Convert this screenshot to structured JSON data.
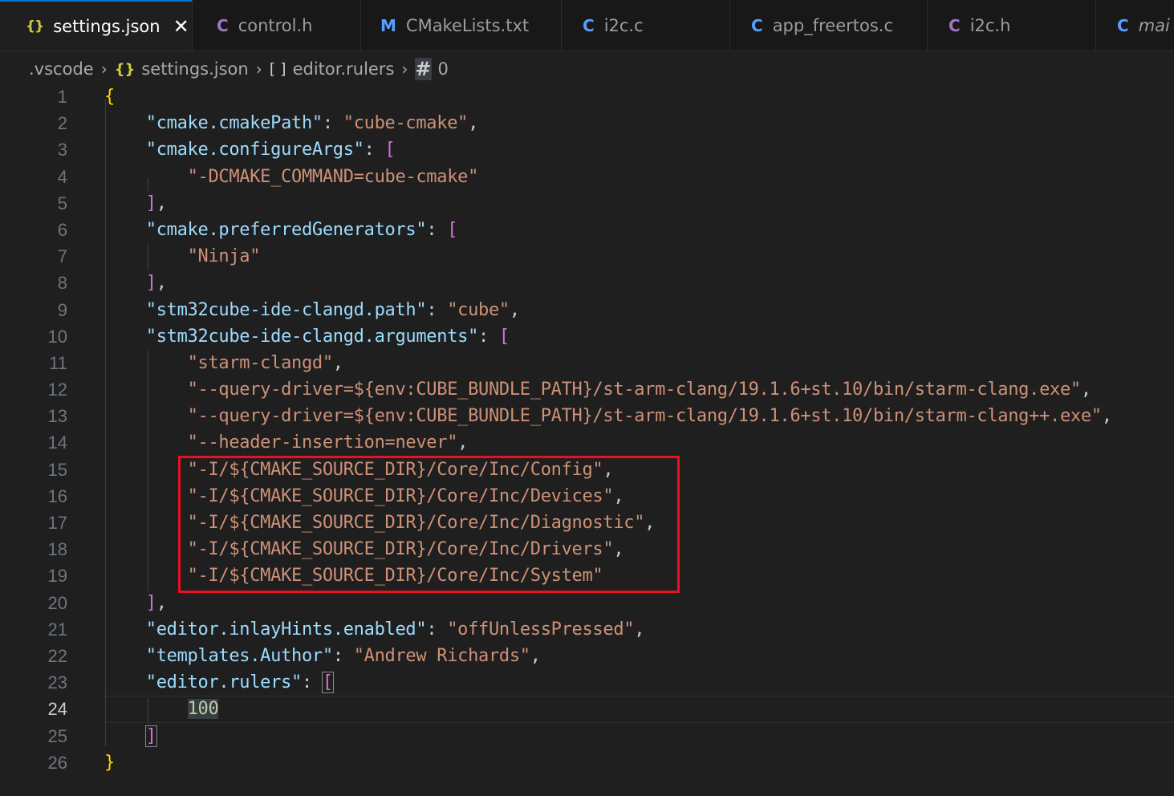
{
  "tabs": [
    {
      "icon": "{}",
      "label": "settings.json",
      "active": true,
      "close": "✕"
    },
    {
      "icon": "C",
      "label": "control.h"
    },
    {
      "icon": "M",
      "label": "CMakeLists.txt"
    },
    {
      "icon": "C",
      "label": "i2c.c"
    },
    {
      "icon": "C",
      "label": "app_freertos.c"
    },
    {
      "icon": "C",
      "label": "i2c.h"
    },
    {
      "icon": "C",
      "label": "mai"
    }
  ],
  "breadcrumb": {
    "folder": ".vscode",
    "file_icon": "{}",
    "file": "settings.json",
    "array_icon": "[ ]",
    "array": "editor.rulers",
    "num_icon": "#",
    "index": "0"
  },
  "editor": {
    "current_line": 24,
    "lines": [
      {
        "n": "1"
      },
      {
        "n": "2"
      },
      {
        "n": "3"
      },
      {
        "n": "4"
      },
      {
        "n": "5"
      },
      {
        "n": "6"
      },
      {
        "n": "7"
      },
      {
        "n": "8"
      },
      {
        "n": "9"
      },
      {
        "n": "10"
      },
      {
        "n": "11"
      },
      {
        "n": "12"
      },
      {
        "n": "13"
      },
      {
        "n": "14"
      },
      {
        "n": "15"
      },
      {
        "n": "16"
      },
      {
        "n": "17"
      },
      {
        "n": "18"
      },
      {
        "n": "19"
      },
      {
        "n": "20"
      },
      {
        "n": "21"
      },
      {
        "n": "22"
      },
      {
        "n": "23"
      },
      {
        "n": "24"
      },
      {
        "n": "25"
      },
      {
        "n": "26"
      }
    ],
    "code": {
      "open_brace": "{",
      "close_brace": "}",
      "k_cmakePath": "\"cmake.cmakePath\"",
      "v_cmakePath": "\"cube-cmake\"",
      "k_configureArgs": "\"cmake.configureArgs\"",
      "v_configureArgs_0": "\"-DCMAKE_COMMAND=cube-cmake\"",
      "k_preferredGenerators": "\"cmake.preferredGenerators\"",
      "v_preferredGenerators_0": "\"Ninja\"",
      "k_clangd_path": "\"stm32cube-ide-clangd.path\"",
      "v_clangd_path": "\"cube\"",
      "k_clangd_arguments": "\"stm32cube-ide-clangd.arguments\"",
      "arg_0": "\"starm-clangd\"",
      "arg_1": "\"--query-driver=${env:CUBE_BUNDLE_PATH}/st-arm-clang/19.1.6+st.10/bin/starm-clang.exe\"",
      "arg_2": "\"--query-driver=${env:CUBE_BUNDLE_PATH}/st-arm-clang/19.1.6+st.10/bin/starm-clang++.exe\"",
      "arg_3": "\"--header-insertion=never\"",
      "arg_4": "\"-I/${CMAKE_SOURCE_DIR}/Core/Inc/Config\"",
      "arg_5": "\"-I/${CMAKE_SOURCE_DIR}/Core/Inc/Devices\"",
      "arg_6": "\"-I/${CMAKE_SOURCE_DIR}/Core/Inc/Diagnostic\"",
      "arg_7": "\"-I/${CMAKE_SOURCE_DIR}/Core/Inc/Drivers\"",
      "arg_8": "\"-I/${CMAKE_SOURCE_DIR}/Core/Inc/System\"",
      "k_inlayHints": "\"editor.inlayHints.enabled\"",
      "v_inlayHints": "\"offUnlessPressed\"",
      "k_author": "\"templates.Author\"",
      "v_author": "\"Andrew Richards\"",
      "k_rulers": "\"editor.rulers\"",
      "v_rulers_0": "100"
    }
  },
  "colors": {
    "key": "#9cdcfe",
    "string": "#ce9178",
    "number": "#b5cea8",
    "highlight_box": "#e81123",
    "active_tab_accent": "#0078d4"
  }
}
